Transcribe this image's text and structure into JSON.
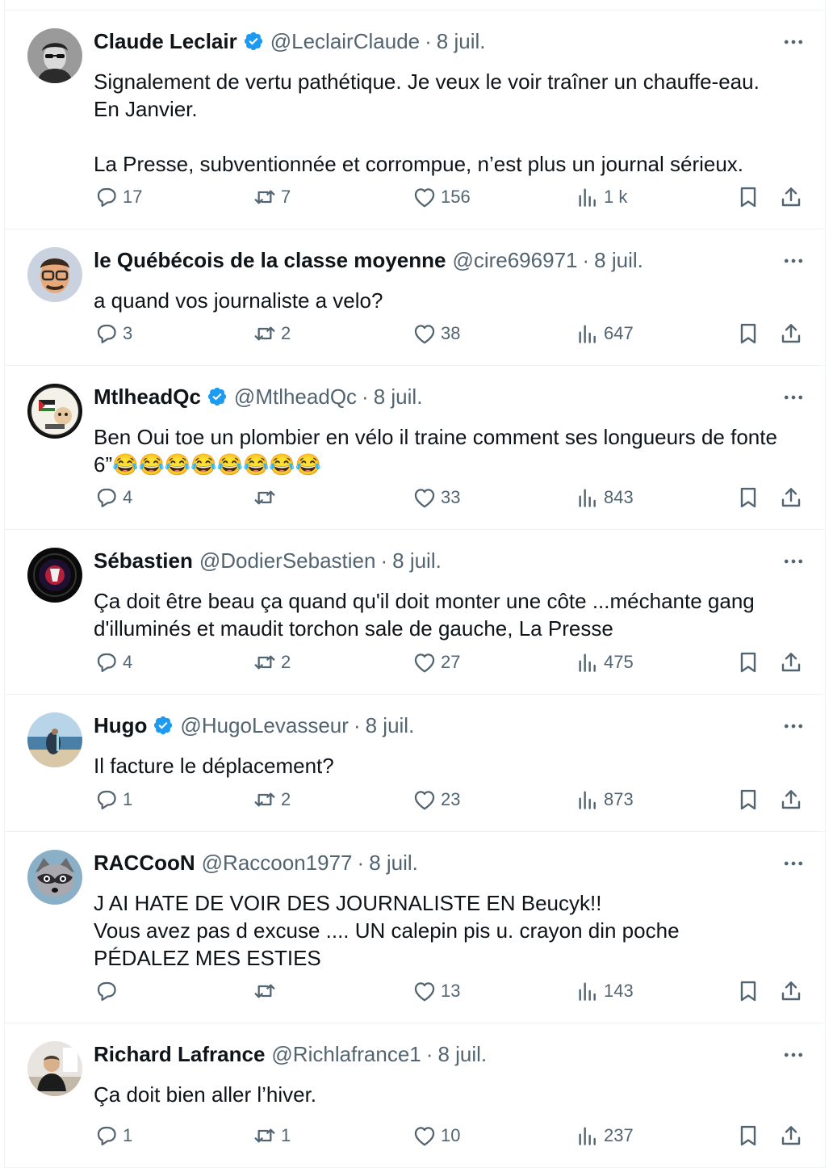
{
  "tweets": [
    {
      "name": "Claude Leclair",
      "verified": true,
      "handle": "@LeclairClaude",
      "date": "8 juil.",
      "lines": [
        "Signalement de vertu pathétique. Je veux le voir traîner un chauffe-eau.",
        "En Janvier.",
        "",
        "La Presse, subventionnée et corrompue, n’est plus un journal sérieux."
      ],
      "replies": "17",
      "retweets": "7",
      "likes": "156",
      "views": "1 k",
      "avatar": "portrait-sunglasses"
    },
    {
      "name": "le Québécois de la classe moyenne",
      "verified": false,
      "handle": "@cire696971",
      "date": "8 juil.",
      "lines": [
        "a quand vos journaliste a velo?"
      ],
      "replies": "3",
      "retweets": "2",
      "likes": "38",
      "views": "647",
      "avatar": "memoji-glasses"
    },
    {
      "name": "MtlheadQc",
      "verified": true,
      "handle": "@MtlheadQc",
      "date": "8 juil.",
      "lines": [
        "Ben Oui toe un plombier en vélo il traine comment ses longueurs de fonte",
        "6”😂😂😂😂😂😂😂😂"
      ],
      "replies": "4",
      "retweets": "",
      "likes": "33",
      "views": "843",
      "avatar": "cartoon-badge"
    },
    {
      "name": "Sébastien",
      "verified": false,
      "handle": "@DodierSebastien",
      "date": "8 juil.",
      "lines": [
        "Ça doit être beau ça quand qu'il doit monter une côte ...méchante gang",
        "d'illuminés et maudit torchon sale de gauche, La Presse"
      ],
      "replies": "4",
      "retweets": "2",
      "likes": "27",
      "views": "475",
      "avatar": "dark-emblem"
    },
    {
      "name": "Hugo",
      "verified": true,
      "handle": "@HugoLevasseur",
      "date": "8 juil.",
      "lines": [
        "Il facture le déplacement?"
      ],
      "replies": "1",
      "retweets": "2",
      "likes": "23",
      "views": "873",
      "avatar": "beach-photo"
    },
    {
      "name": "RACCooN",
      "verified": false,
      "handle": "@Raccoon1977",
      "date": "8 juil.",
      "lines": [
        "J AI HATE DE VOIR DES JOURNALISTE EN Beucyk!!",
        "Vous avez pas d excuse .... UN calepin pis u. crayon din poche",
        "PÉDALEZ MES ESTIES"
      ],
      "replies": "",
      "retweets": "",
      "likes": "13",
      "views": "143",
      "avatar": "raccoon"
    },
    {
      "name": "Richard Lafrance",
      "verified": false,
      "handle": "@Richlafrance1",
      "date": "8 juil.",
      "lines": [
        "Ça doit bien aller l’hiver."
      ],
      "replies": "1",
      "retweets": "1",
      "likes": "10",
      "views": "237",
      "avatar": "portrait-office"
    }
  ],
  "colors": {
    "text": "#0f1419",
    "muted": "#536471",
    "verified": "#1d9bf0",
    "divider": "#eff3f4"
  },
  "icons": [
    "verified-badge-icon",
    "more-icon",
    "reply-icon",
    "retweet-icon",
    "like-icon",
    "views-icon",
    "bookmark-icon",
    "share-icon"
  ]
}
